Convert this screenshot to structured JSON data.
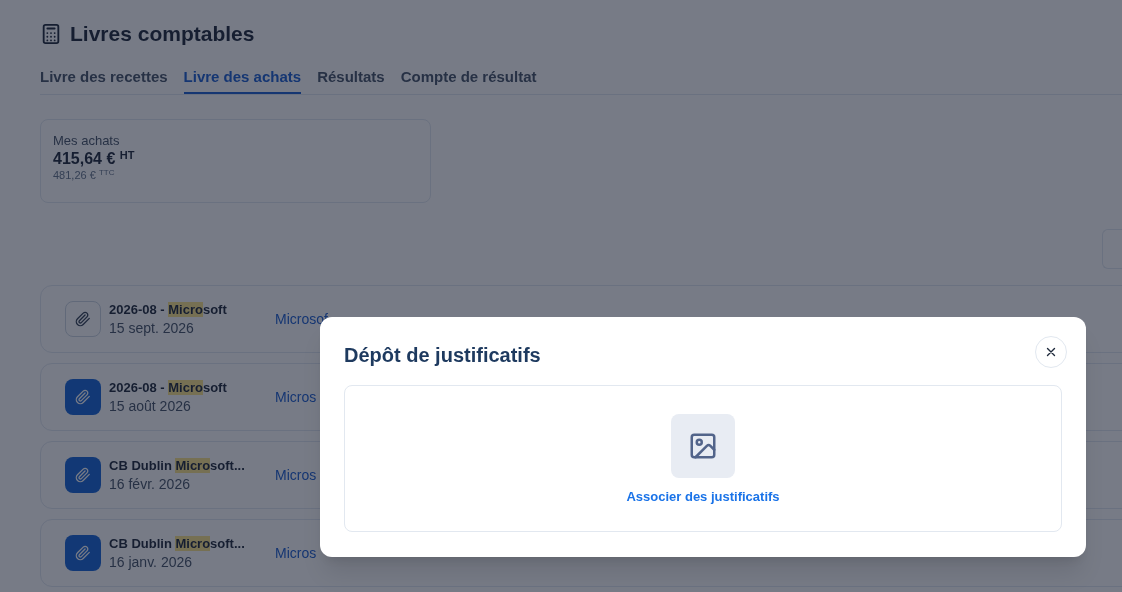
{
  "page": {
    "title": "Livres comptables"
  },
  "tabs": [
    {
      "label": "Livre des recettes",
      "selected": false
    },
    {
      "label": "Livre des achats",
      "selected": true
    },
    {
      "label": "Résultats",
      "selected": false
    },
    {
      "label": "Compte de résultat",
      "selected": false
    }
  ],
  "summary_card": {
    "label": "Mes achats",
    "amount": "415,64 €",
    "amount_suffix": "HT",
    "secondary_amount": "481,26 €",
    "secondary_suffix": "TTC"
  },
  "rows": [
    {
      "title_before": "2026-08 - ",
      "title_match": "Micro",
      "title_after": "soft",
      "date": "15 sept. 2026",
      "column_2": "Microsof",
      "has_attachment": false
    },
    {
      "title_before": "2026-08 - ",
      "title_match": "Micro",
      "title_after": "soft",
      "date": "15 août 2026",
      "column_2": "Micros",
      "has_attachment": true
    },
    {
      "title_before": "CB Dublin ",
      "title_match": "Micro",
      "title_after": "soft...",
      "date": "16 févr. 2026",
      "column_2": "Micros",
      "has_attachment": true
    },
    {
      "title_before": "CB Dublin ",
      "title_match": "Micro",
      "title_after": "soft...",
      "date": "16 janv. 2026",
      "column_2": "Micros",
      "has_attachment": true
    }
  ],
  "dialog": {
    "title": "Dépôt de justificatifs",
    "dropzone_action": "Associer des justificatifs"
  }
}
